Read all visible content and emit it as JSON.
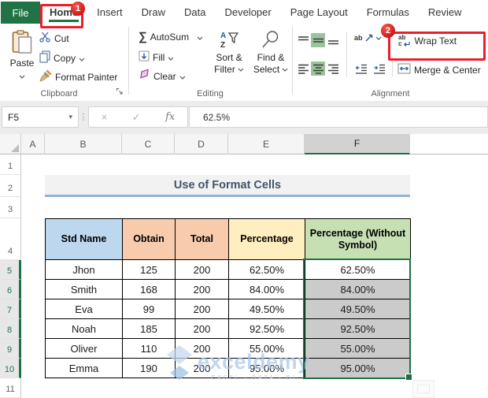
{
  "tab_bar": {
    "file": "File",
    "tabs": [
      "Home",
      "Insert",
      "Draw",
      "Data",
      "Developer",
      "Page Layout",
      "Formulas",
      "Review"
    ],
    "selected": "Home"
  },
  "annotations": {
    "step1": "1",
    "step2": "2",
    "annotation_color": "#e8202c"
  },
  "ribbon": {
    "clipboard": {
      "label": "Clipboard",
      "paste": "Paste",
      "cut": "Cut",
      "copy": "Copy",
      "format_painter": "Format Painter"
    },
    "editing": {
      "label": "Editing",
      "autosum": "AutoSum",
      "fill": "Fill",
      "clear": "Clear",
      "sort_line1": "Sort &",
      "sort_line2": "Filter",
      "find_line1": "Find &",
      "find_line2": "Select"
    },
    "alignment": {
      "label": "Alignment",
      "wrap_text": "Wrap Text",
      "merge_center": "Merge & Center",
      "orientation_glyph": "ab"
    },
    "glyphs": {
      "sigma": "∑",
      "cancel": "×",
      "enter": "✓",
      "fx": "fx",
      "dots": "⋮",
      "namebox_chevron": "▾"
    }
  },
  "formula_bar": {
    "name_box": "F5",
    "value": "62.5%"
  },
  "sheet": {
    "col_headers": [
      "A",
      "B",
      "C",
      "D",
      "E",
      "F"
    ],
    "selected_col": "F",
    "row_headers": [
      "1",
      "2",
      "3",
      "4",
      "5",
      "6",
      "7",
      "8",
      "9",
      "10",
      "11"
    ],
    "selected_rows": [
      "5",
      "6",
      "7",
      "8",
      "9",
      "10"
    ],
    "title": "Use of Format Cells",
    "table": {
      "headers": [
        "Std Name",
        "Obtain",
        "Total",
        "Percentage",
        "Percentage (Without Symbol)"
      ],
      "rows": [
        [
          "Jhon",
          "125",
          "200",
          "62.50%",
          "62.50%"
        ],
        [
          "Smith",
          "168",
          "200",
          "84.00%",
          "84.00%"
        ],
        [
          "Eva",
          "99",
          "200",
          "49.50%",
          "49.50%"
        ],
        [
          "Noah",
          "185",
          "200",
          "92.50%",
          "92.50%"
        ],
        [
          "Oliver",
          "110",
          "200",
          "55.00%",
          "55.00%"
        ],
        [
          "Emma",
          "190",
          "200",
          "95.00%",
          "95.00%"
        ]
      ],
      "active_cell": "F5"
    },
    "watermark": {
      "brand": "exceldemy",
      "tagline": "EXCEL - DATA - BI"
    }
  },
  "colors": {
    "accent_green": "#217346",
    "file_tab_bg": "#217346",
    "annotation_red": "#e8202c",
    "header_fills": [
      "#bdd7ee",
      "#f8cbad",
      "#f8cbad",
      "#ffeebf",
      "#c6e0b4"
    ],
    "selected_fill": "#cbcbcb",
    "active_cell_fill": "#ffffff",
    "title_text": "#44546a",
    "title_underline": "#95b3d7",
    "selected_align_bg": "#9cc49c",
    "watermark_blue": "#a9c8e8"
  }
}
